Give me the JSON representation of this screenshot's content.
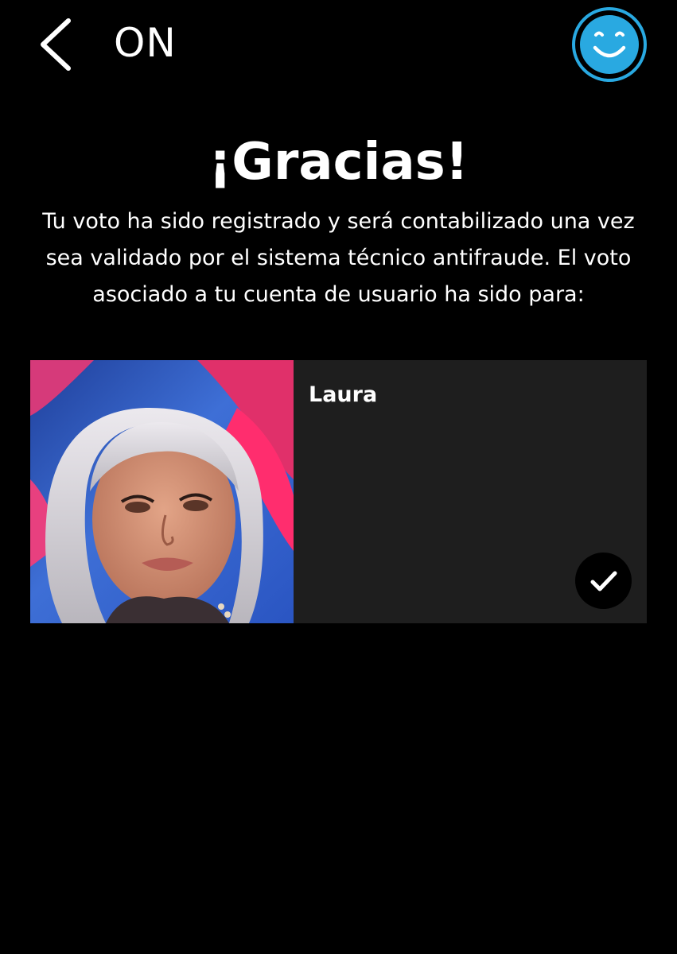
{
  "header": {
    "logo_text": "ON",
    "back_icon": "chevron-left-icon",
    "profile_icon": "smiley-face-icon"
  },
  "confirmation": {
    "title": "¡Gracias!",
    "message": "Tu voto ha sido registrado y será contabilizado una vez sea validado por el sistema técnico antifraude. El voto asociado a tu cuenta de usuario ha sido para:"
  },
  "vote_card": {
    "candidate_name": "Laura",
    "photo": "candidate-photo",
    "selected": true,
    "status_icon": "checkmark-icon"
  },
  "colors": {
    "background": "#000000",
    "card_background": "#1e1e1e",
    "accent": "#29a9e1",
    "text": "#ffffff"
  }
}
